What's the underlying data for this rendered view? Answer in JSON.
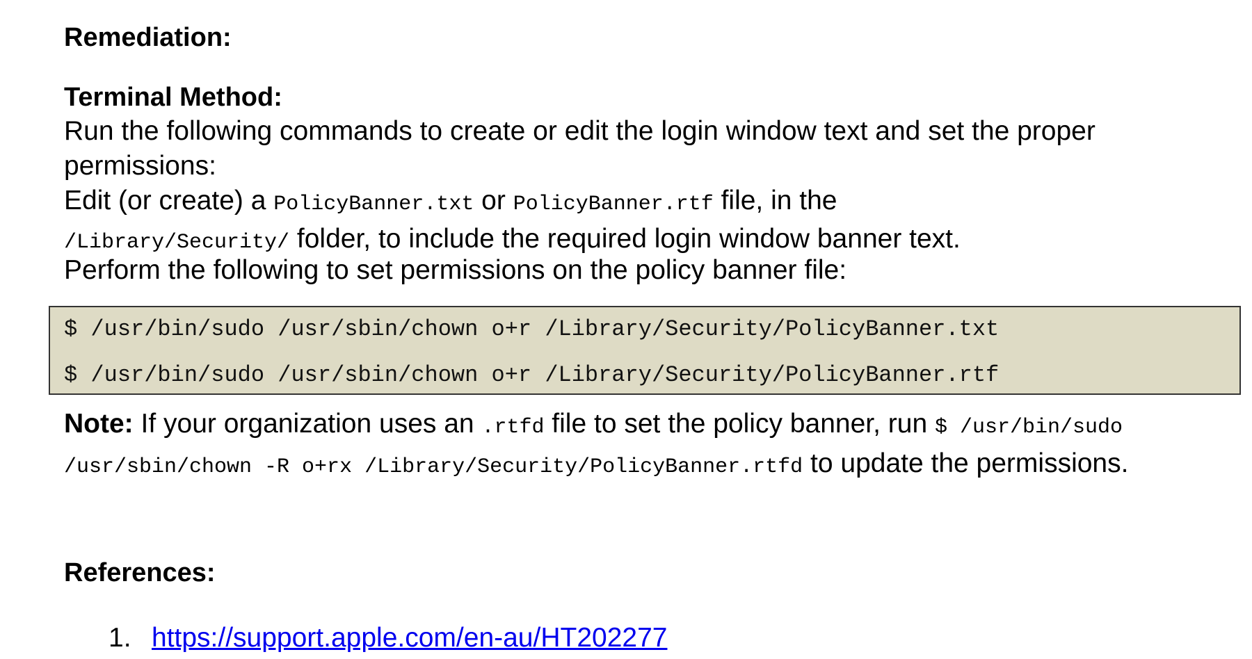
{
  "remediation": {
    "heading": "Remediation:"
  },
  "terminal": {
    "heading": "Terminal Method:",
    "intro": "Run the following commands to create or edit the login window text and set the proper permissions:",
    "edit": {
      "prefix": "Edit (or create) a ",
      "file_txt": "PolicyBanner.txt",
      "or": " or ",
      "file_rtf": "PolicyBanner.rtf",
      "mid": " file, in the ",
      "folder": "/Library/Security/",
      "suffix": " folder, to include the required login window banner text."
    },
    "perform": "Perform the following to set permissions on the policy banner file:",
    "commands": [
      "$ /usr/bin/sudo /usr/sbin/chown o+r /Library/Security/PolicyBanner.txt",
      "$ /usr/bin/sudo /usr/sbin/chown o+r /Library/Security/PolicyBanner.rtf"
    ],
    "code_bg": "#dedbc5"
  },
  "note": {
    "label": "Note:",
    "text1": " If your organization uses an ",
    "ext": ".rtfd",
    "text2": " file to set the policy banner, run ",
    "command": "$ /usr/bin/sudo /usr/sbin/chown -R o+rx /Library/Security/PolicyBanner.rtfd",
    "text3": " to update the permissions."
  },
  "references": {
    "heading": "References:",
    "items": [
      {
        "number": "1.",
        "link": "https://support.apple.com/en-au/HT202277"
      }
    ],
    "link_color": "#0000ee"
  }
}
